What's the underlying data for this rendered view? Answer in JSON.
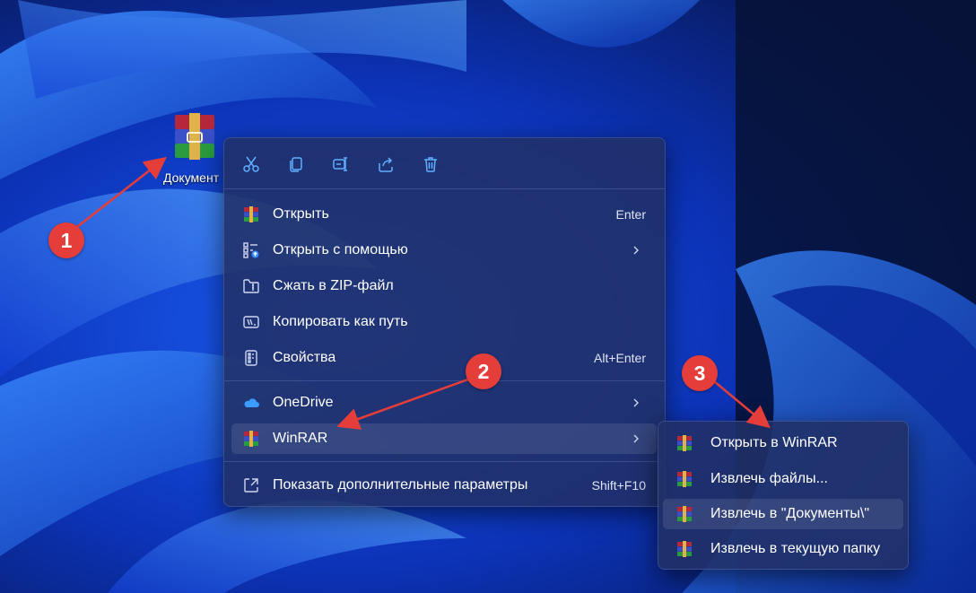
{
  "colors": {
    "menu_bg": "#213066",
    "accent_blue": "#4fa3ff",
    "callout_red": "#e53d3a"
  },
  "desktop": {
    "file_label": "Документ",
    "file_icon": "winrar-archive-icon"
  },
  "toolbar": {
    "buttons": [
      {
        "name": "cut-icon"
      },
      {
        "name": "copy-icon"
      },
      {
        "name": "rename-icon"
      },
      {
        "name": "share-icon"
      },
      {
        "name": "delete-icon"
      }
    ]
  },
  "menu": {
    "items": [
      {
        "label": "Открыть",
        "shortcut": "Enter",
        "icon": "winrar-icon"
      },
      {
        "label": "Открыть с помощью",
        "shortcut": "",
        "icon": "open-with-icon",
        "submenu": true
      },
      {
        "label": "Сжать в ZIP-файл",
        "shortcut": "",
        "icon": "zip-folder-icon"
      },
      {
        "label": "Копировать как путь",
        "shortcut": "",
        "icon": "copy-path-icon"
      },
      {
        "label": "Свойства",
        "shortcut": "Alt+Enter",
        "icon": "properties-icon"
      },
      {
        "label": "OneDrive",
        "shortcut": "",
        "icon": "onedrive-icon",
        "submenu": true
      },
      {
        "label": "WinRAR",
        "shortcut": "",
        "icon": "winrar-icon",
        "submenu": true
      },
      {
        "label": "Показать дополнительные параметры",
        "shortcut": "Shift+F10",
        "icon": "more-options-icon"
      }
    ]
  },
  "submenu": {
    "items": [
      {
        "label": "Открыть в WinRAR"
      },
      {
        "label": "Извлечь файлы..."
      },
      {
        "label": "Извлечь в \"Документы\\\""
      },
      {
        "label": "Извлечь в текущую папку"
      }
    ]
  },
  "callouts": [
    "1",
    "2",
    "3"
  ]
}
